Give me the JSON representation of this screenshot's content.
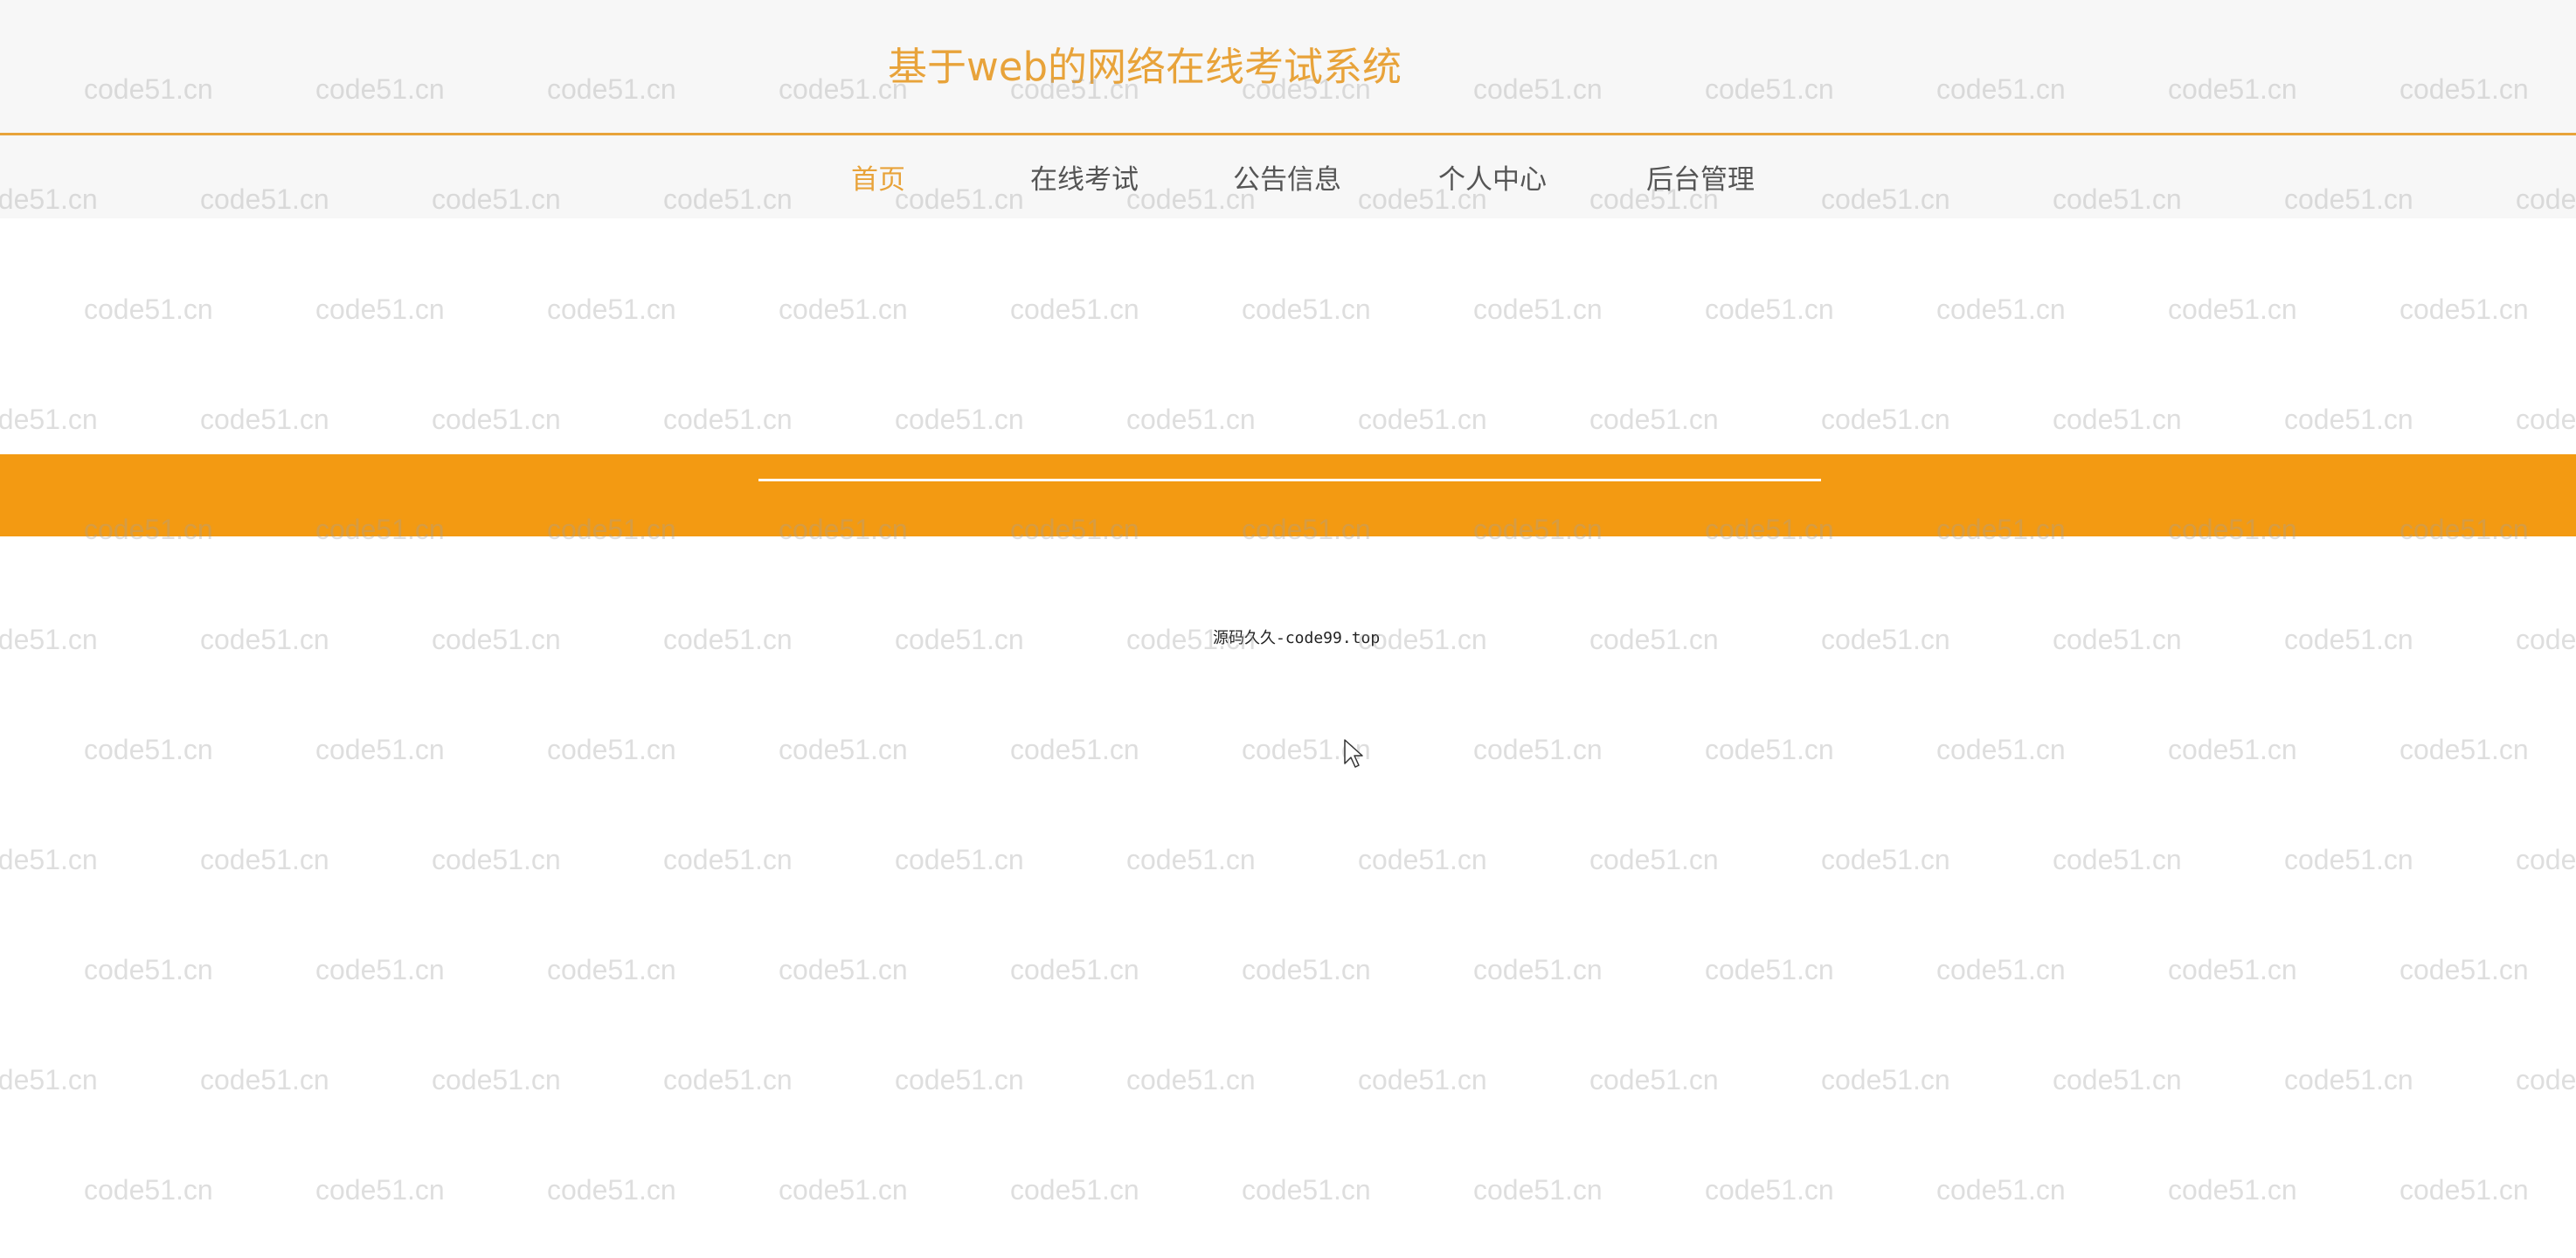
{
  "header": {
    "site_title": "基于web的网络在线考试系统"
  },
  "nav": {
    "items": [
      {
        "label": "首页",
        "active": true
      },
      {
        "label": "在线考试",
        "active": false
      },
      {
        "label": "公告信息",
        "active": false
      },
      {
        "label": "个人中心",
        "active": false
      },
      {
        "label": "后台管理",
        "active": false
      }
    ]
  },
  "footer": {
    "text": "源码久久-code99.top"
  },
  "watermark": {
    "text": "code51.cn"
  },
  "colors": {
    "accent": "#e8a33a",
    "banner": "#f39a12",
    "header_bg": "#f7f7f7"
  }
}
